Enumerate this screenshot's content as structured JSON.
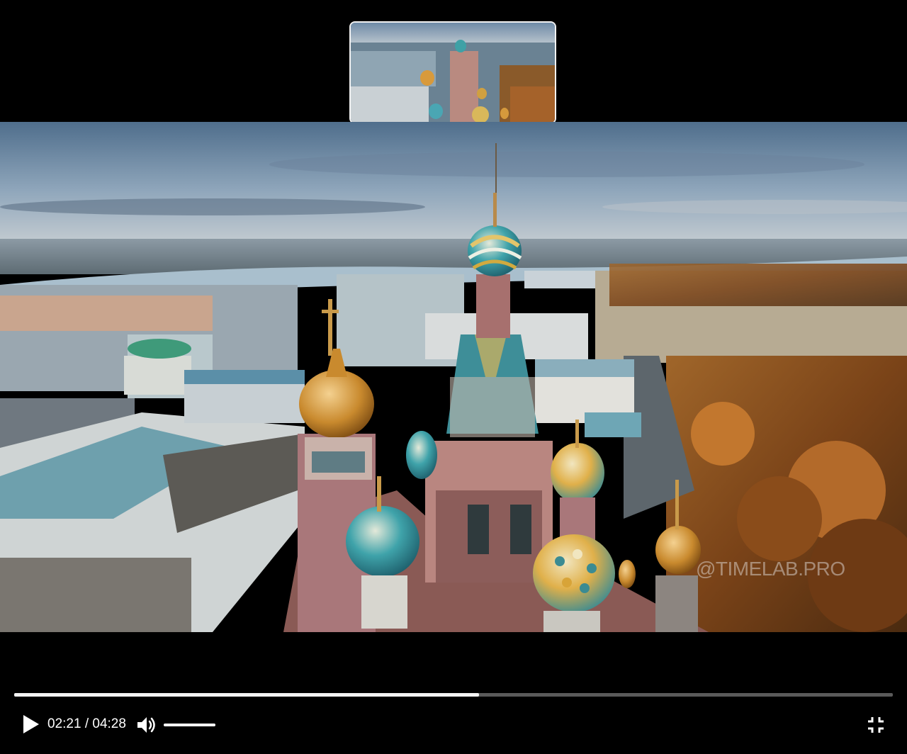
{
  "player": {
    "current_time": "02:21",
    "separator": " / ",
    "duration": "04:28",
    "progress_fraction": 0.529,
    "volume_fraction": 1.0,
    "watermark": "@TIMELAB.PRO"
  },
  "icons": {
    "play": "play-icon",
    "volume": "volume-high-icon",
    "fullscreen_exit": "fullscreen-exit-icon"
  },
  "colors": {
    "background": "#000000",
    "progress_played": "#f2f2f2",
    "progress_remaining": "#5a5a5a",
    "icon": "#ffffff"
  }
}
